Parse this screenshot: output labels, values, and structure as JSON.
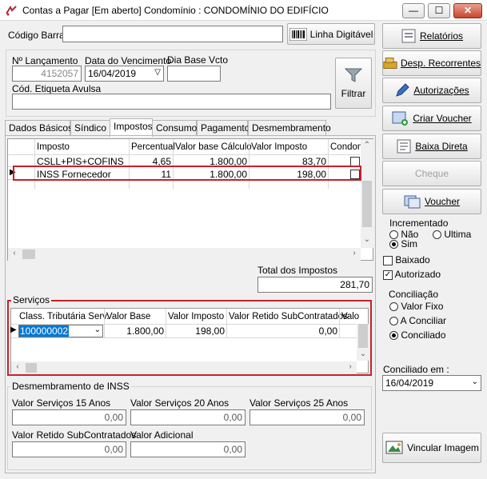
{
  "window": {
    "title": "Contas a Pagar  [Em aberto]  Condomínio : CONDOMÍNIO DO EDIFÍCIO",
    "minimize": "—",
    "maximize": "☐",
    "close": "✕"
  },
  "form": {
    "codigo_barra_label": "Código Barra",
    "codigo_barra_value": "",
    "linha_digitavel_label": "Linha Digitável",
    "lancamento_label": "Nº Lançamento",
    "lancamento_value": "4152057",
    "vencimento_label": "Data do Vencimento",
    "vencimento_value": "16/04/2019",
    "dia_base_label": "Dia Base Vcto",
    "dia_base_value": "",
    "etiqueta_label": "Cód. Etiqueta Avulsa",
    "etiqueta_value": "",
    "filtrar_label": "Filtrar"
  },
  "tabs": [
    {
      "label": "Dados Básicos"
    },
    {
      "label": "Síndico"
    },
    {
      "label": "Impostos",
      "active": true
    },
    {
      "label": "Consumo"
    },
    {
      "label": "Pagamento"
    },
    {
      "label": "Desmembramento"
    }
  ],
  "impostos": {
    "columns": [
      "Imposto",
      "Percentual",
      "Valor base Cálculo",
      "Valor Imposto",
      "Condom"
    ],
    "rows": [
      {
        "imposto": "CSLL+PIS+COFINS",
        "percentual": "4,65",
        "base": "1.800,00",
        "valor": "83,70",
        "condom": false
      },
      {
        "imposto": "INSS Fornecedor",
        "percentual": "11",
        "base": "1.800,00",
        "valor": "198,00",
        "condom": false
      }
    ],
    "total_label": "Total dos Impostos",
    "total_value": "281,70"
  },
  "servicos": {
    "title": "Serviços",
    "columns": [
      "Class. Tributária Serv.",
      "Valor Base",
      "Valor Imposto",
      "Valor Retido SubContratados",
      "Valo"
    ],
    "row": {
      "classificacao": "100000002",
      "base": "1.800,00",
      "imposto": "198,00",
      "retido": "0,00"
    }
  },
  "desmembramento": {
    "title": "Desmembramento de INSS",
    "fields": [
      {
        "label": "Valor Serviços 15 Anos",
        "value": "0,00"
      },
      {
        "label": "Valor Serviços 20 Anos",
        "value": "0,00"
      },
      {
        "label": "Valor Serviços 25 Anos",
        "value": "0,00"
      },
      {
        "label": "Valor Retido SubContratados",
        "value": "0,00"
      },
      {
        "label": "Valor Adicional",
        "value": "0,00"
      }
    ]
  },
  "side_buttons": {
    "relatorios": "Relatórios",
    "desp_recorrentes": "Desp. Recorrentes",
    "autorizacoes": "Autorizações",
    "criar_voucher": "Criar Voucher",
    "baixa_direta": "Baixa Direta",
    "cheque": "Cheque",
    "voucher": "Voucher",
    "vincular_imagem": "Vincular Imagem"
  },
  "incrementado": {
    "title": "Incrementado",
    "options": [
      "Não",
      "Ultima",
      "Sim"
    ],
    "selected": "Sim"
  },
  "checks": {
    "baixado_label": "Baixado",
    "baixado": false,
    "autorizado_label": "Autorizado",
    "autorizado": true
  },
  "conciliacao": {
    "title": "Conciliação",
    "options": [
      "Valor Fixo",
      "A Conciliar",
      "Conciliado"
    ],
    "selected": "Conciliado",
    "conciliado_em_label": "Conciliado em :",
    "conciliado_em_value": "16/04/2019"
  },
  "colors": {
    "highlight": "#c8202a",
    "selection": "#0078d7"
  }
}
